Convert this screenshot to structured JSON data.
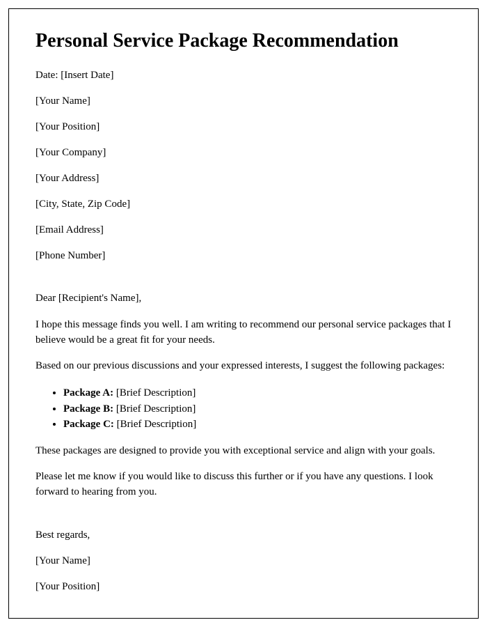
{
  "title": "Personal Service Package Recommendation",
  "header": {
    "date": "Date: [Insert Date]",
    "name": "[Your Name]",
    "position": "[Your Position]",
    "company": "[Your Company]",
    "address": "[Your Address]",
    "city_state_zip": "[City, State, Zip Code]",
    "email": "[Email Address]",
    "phone": "[Phone Number]"
  },
  "salutation": "Dear [Recipient's Name],",
  "body": {
    "intro": "I hope this message finds you well. I am writing to recommend our personal service packages that I believe would be a great fit for your needs.",
    "lead_in": "Based on our previous discussions and your expressed interests, I suggest the following packages:",
    "packages": [
      {
        "name": "Package A:",
        "desc": " [Brief Description]"
      },
      {
        "name": "Package B:",
        "desc": " [Brief Description]"
      },
      {
        "name": "Package C:",
        "desc": " [Brief Description]"
      }
    ],
    "benefit": "These packages are designed to provide you with exceptional service and align with your goals.",
    "closing_ask": "Please let me know if you would like to discuss this further or if you have any questions. I look forward to hearing from you."
  },
  "signoff": {
    "regards": "Best regards,",
    "name": "[Your Name]",
    "position": "[Your Position]"
  }
}
